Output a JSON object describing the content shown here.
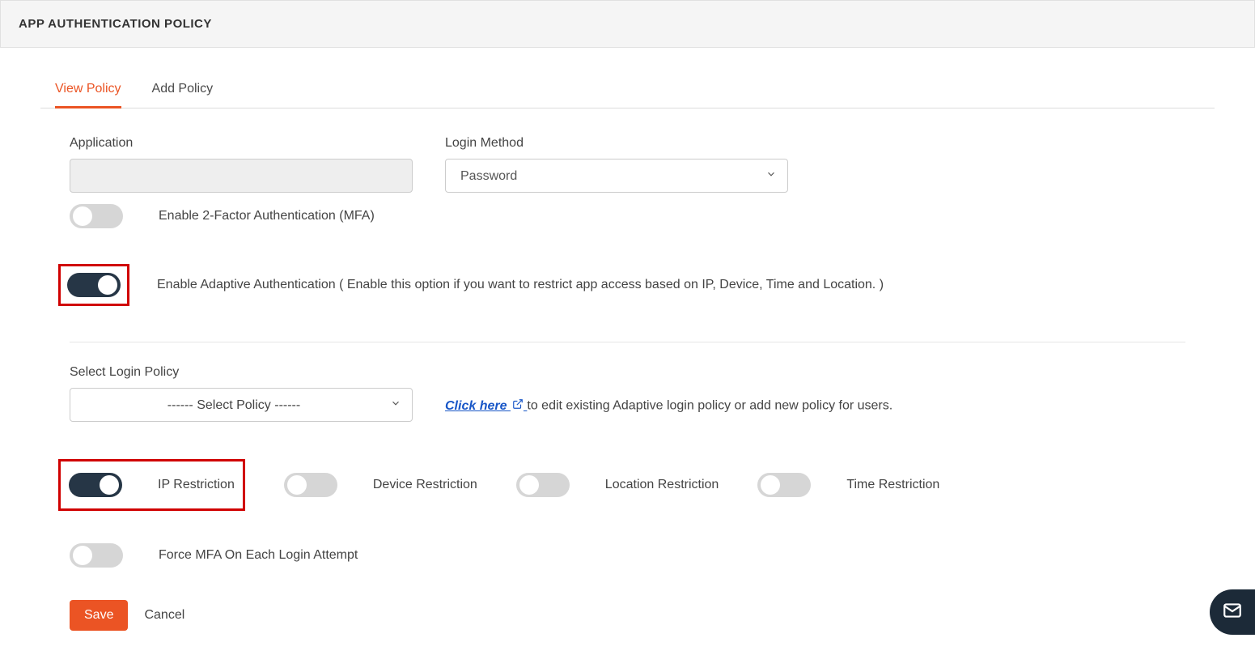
{
  "header": {
    "title": "APP AUTHENTICATION POLICY"
  },
  "tabs": {
    "view": "View Policy",
    "add": "Add Policy"
  },
  "fields": {
    "application_label": "Application",
    "application_value": "",
    "login_method_label": "Login Method",
    "login_method_value": "Password"
  },
  "toggles": {
    "mfa_label": "Enable 2-Factor Authentication (MFA)",
    "adaptive_label": "Enable Adaptive Authentication ( Enable this option if you want to restrict app access based on IP, Device, Time and Location. )"
  },
  "policy": {
    "select_label": "Select Login Policy",
    "select_placeholder": "------ Select Policy ------",
    "click_here": "Click here",
    "hint_rest": " to edit existing Adaptive login policy or add new policy for users."
  },
  "restrictions": {
    "ip": "IP Restriction",
    "device": "Device Restriction",
    "location": "Location Restriction",
    "time": "Time Restriction"
  },
  "force_mfa_label": "Force MFA On Each Login Attempt",
  "actions": {
    "save": "Save",
    "cancel": "Cancel"
  }
}
